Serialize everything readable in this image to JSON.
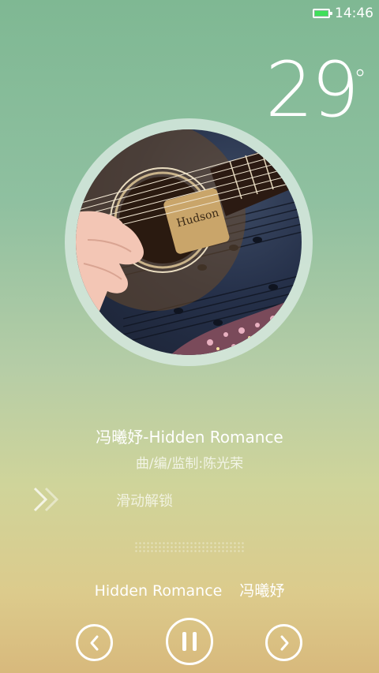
{
  "status_bar": {
    "time": "14:46",
    "battery_icon": "battery-icon",
    "battery_color": "#3fe05a"
  },
  "weather": {
    "temperature": "29",
    "unit": "°"
  },
  "song": {
    "title": "冯曦妤-Hidden Romance",
    "credit": "曲/编/监制:陈光荣"
  },
  "unlock": {
    "label": "滑动解锁",
    "icon": "double-chevron-right-icon"
  },
  "now_playing": {
    "title": "Hidden Romance",
    "artist": "冯曦妤"
  },
  "controls": {
    "prev_icon": "chevron-left-icon",
    "pause_icon": "pause-icon",
    "next_icon": "chevron-right-icon"
  },
  "colors": {
    "background_top": "#7fb893",
    "background_bottom": "#d8b97c",
    "text": "#ffffff"
  }
}
